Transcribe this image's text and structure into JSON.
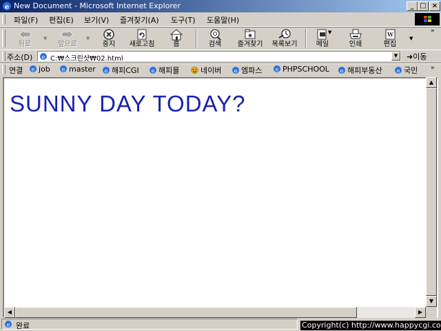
{
  "window": {
    "title": "New Document - Microsoft Internet Explorer"
  },
  "menu": [
    "파일(F)",
    "편집(E)",
    "보기(V)",
    "즐겨찾기(A)",
    "도구(T)",
    "도움말(H)"
  ],
  "toolbar": {
    "back": "뒤로",
    "forward": "앞으로",
    "stop": "중지",
    "refresh": "새로고침",
    "home": "홈",
    "search": "검색",
    "favorites": "즐겨찾기",
    "history": "목록보기",
    "mail": "메일",
    "print": "인쇄",
    "edit": "편집"
  },
  "address": {
    "label": "주소(D)",
    "value": "C:₩스크린샷₩02.html",
    "go": "이동"
  },
  "links": {
    "label": "연결",
    "items": [
      "job",
      "master",
      "해피CGI",
      "해피몰",
      "네이버",
      "엠파스",
      "PHPSCHOOL",
      "해피부동산",
      "국민"
    ]
  },
  "content": {
    "headline": "SUNNY DAY TODAY?"
  },
  "status": {
    "text": "완료",
    "copyright": "Copyright(c) http://www.happycgi.com"
  },
  "colors": {
    "titlebar_start": "#0a246a",
    "titlebar_end": "#a6caf0",
    "headline": "#1a22b0"
  }
}
